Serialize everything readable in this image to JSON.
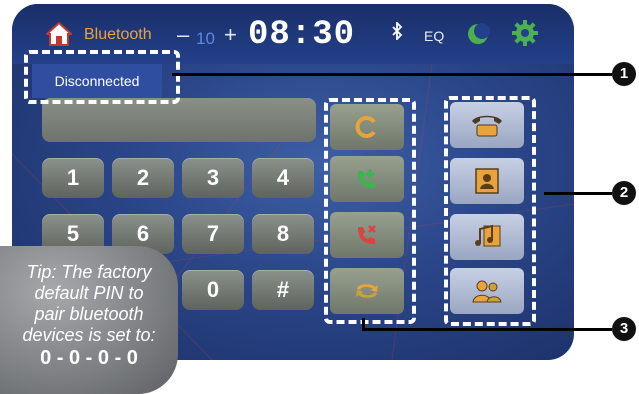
{
  "header": {
    "title": "Bluetooth",
    "volume_minus": "–",
    "volume_value": "10",
    "volume_plus": "+",
    "clock": "08:30",
    "eq_label": "EQ"
  },
  "status": {
    "connection": "Disconnected"
  },
  "keypad": {
    "row1": [
      "1",
      "2",
      "3",
      "4"
    ],
    "row2": [
      "5",
      "6",
      "7",
      "8"
    ],
    "row3": [
      "0",
      "#"
    ]
  },
  "action_buttons": [
    {
      "icon": "clear-icon",
      "color": "#e8a43a"
    },
    {
      "icon": "call-answer-icon",
      "color": "#36b84a"
    },
    {
      "icon": "call-end-icon",
      "color": "#e04040"
    },
    {
      "icon": "transfer-audio-icon",
      "color": "#e8a43a"
    }
  ],
  "side_buttons": [
    {
      "icon": "phone-icon"
    },
    {
      "icon": "phonebook-icon"
    },
    {
      "icon": "music-icon"
    },
    {
      "icon": "paired-devices-icon"
    }
  ],
  "tip": {
    "lines": [
      "Tip: The factory",
      "default PIN to",
      "pair bluetooth",
      "devices is set to:"
    ],
    "pin": "0 - 0 - 0 - 0"
  },
  "callouts": [
    "1",
    "2",
    "3"
  ],
  "colors": {
    "accent": "#e8a43a",
    "screen_bg": "#2a4588",
    "callout": "#111111"
  }
}
